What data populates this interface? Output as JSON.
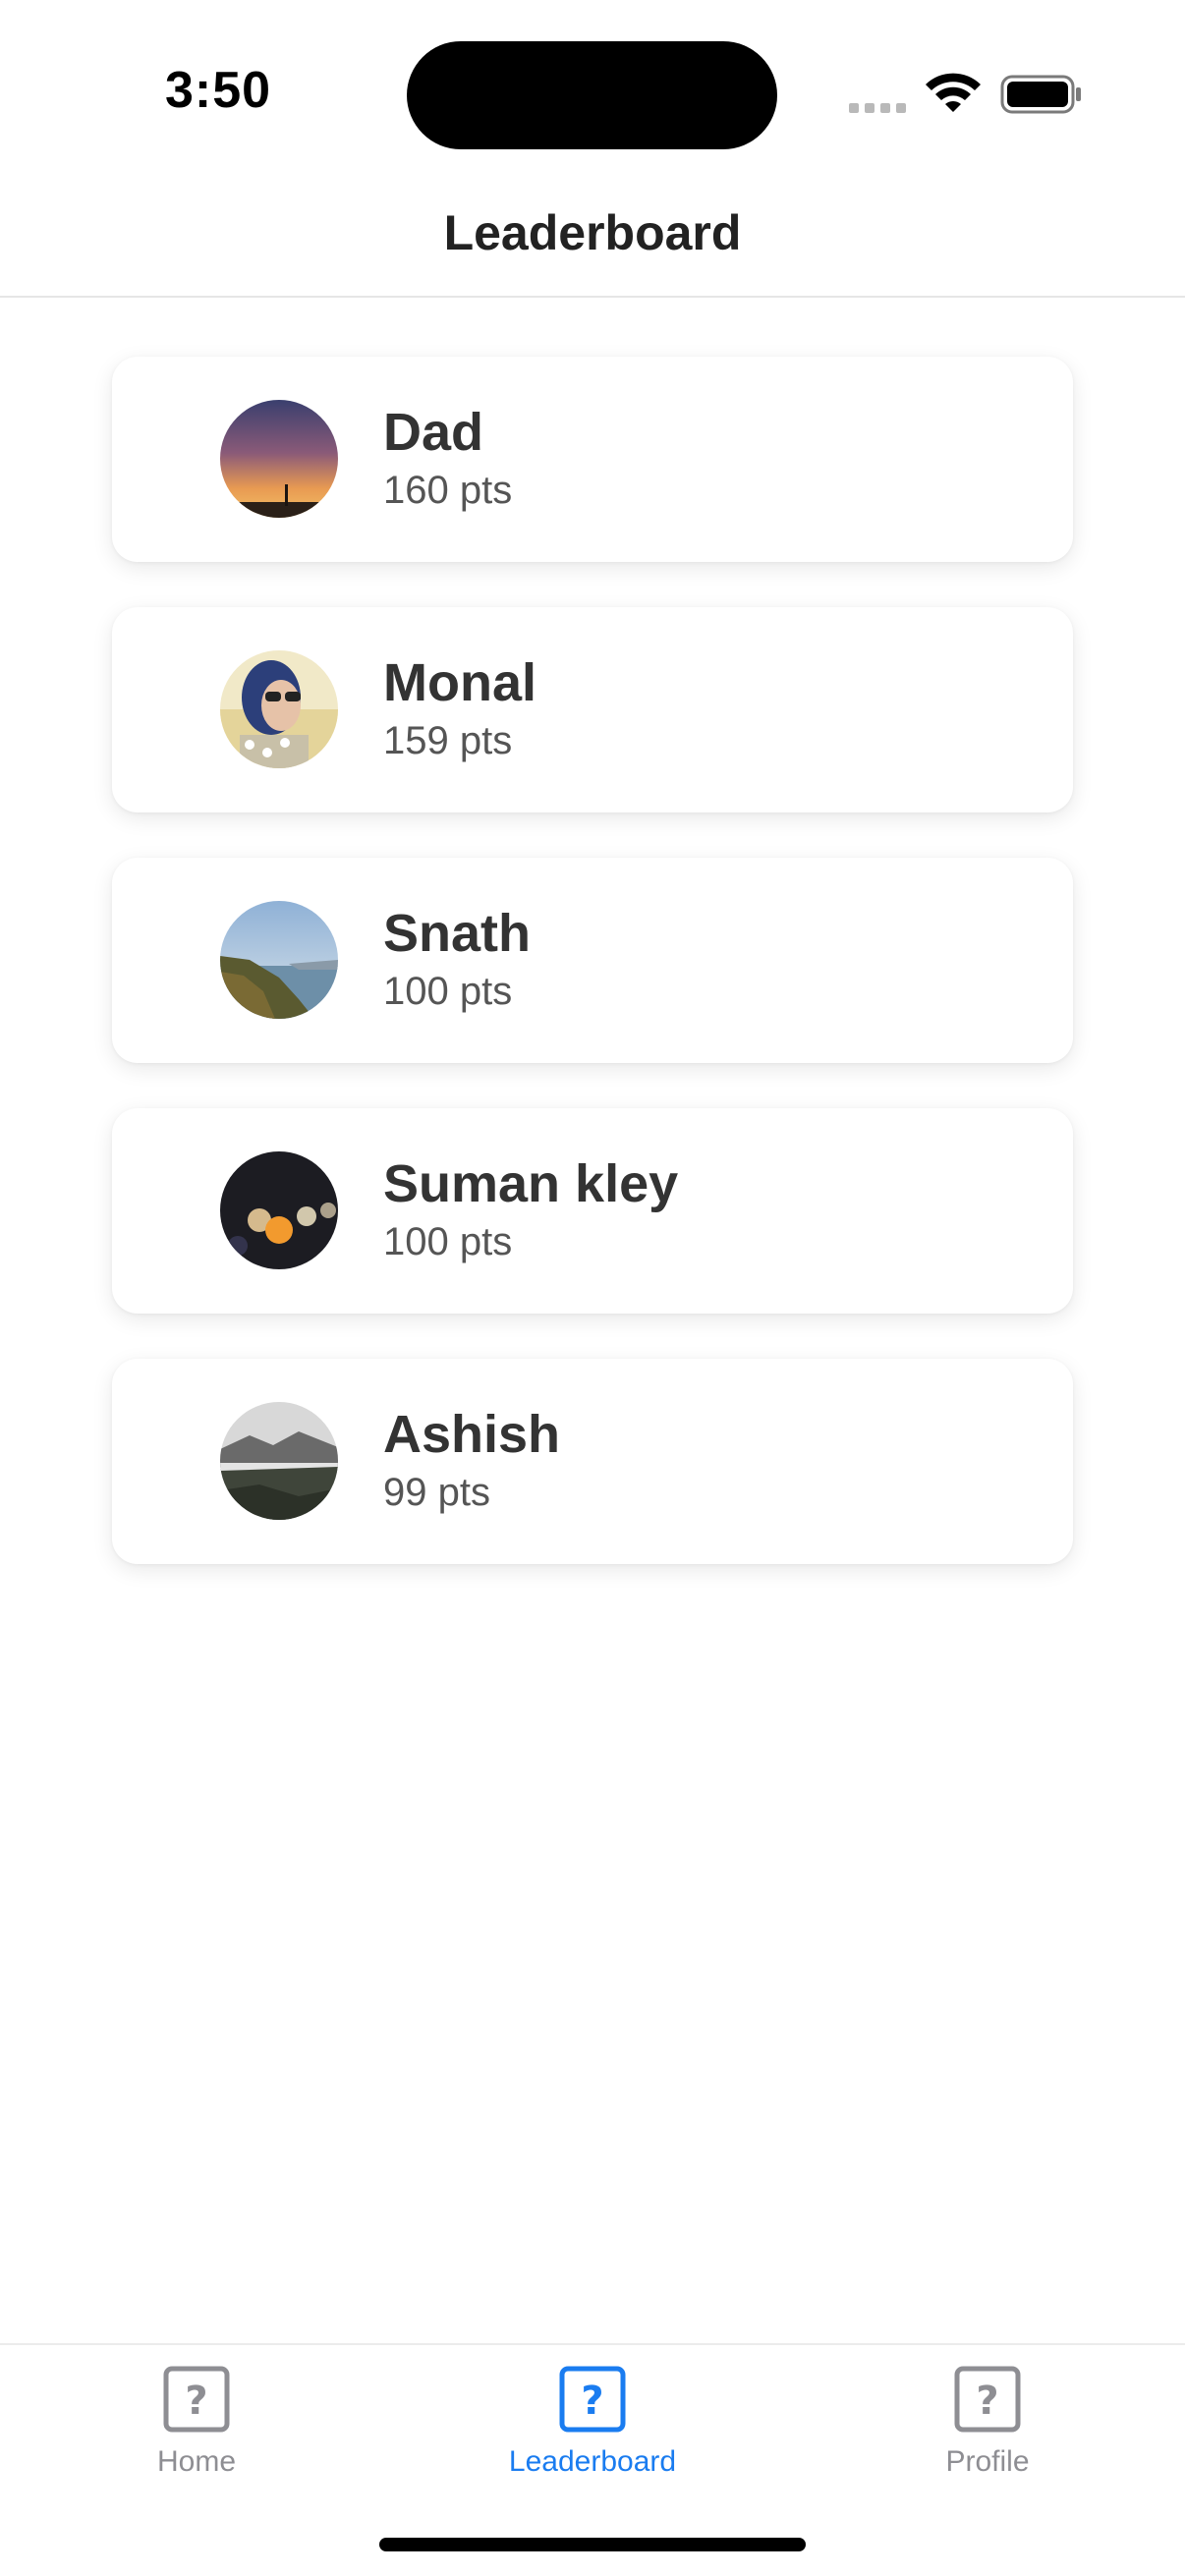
{
  "status_bar": {
    "time": "3:50"
  },
  "header": {
    "title": "Leaderboard"
  },
  "leaderboard": [
    {
      "name": "Dad",
      "points": "160 pts",
      "avatar": "sunset-avatar"
    },
    {
      "name": "Monal",
      "points": "159 pts",
      "avatar": "portrait-avatar"
    },
    {
      "name": "Snath",
      "points": "100 pts",
      "avatar": "coast-avatar"
    },
    {
      "name": "Suman kley",
      "points": "100 pts",
      "avatar": "bokeh-lights-avatar"
    },
    {
      "name": "Ashish",
      "points": "99 pts",
      "avatar": "mountain-lake-avatar"
    }
  ],
  "tabs": [
    {
      "label": "Home",
      "icon": "question-square-icon",
      "active": false
    },
    {
      "label": "Leaderboard",
      "icon": "question-square-icon",
      "active": true
    },
    {
      "label": "Profile",
      "icon": "question-square-icon",
      "active": false
    }
  ],
  "colors": {
    "accent": "#1a7cf0",
    "inactive_tab": "#8e8e93",
    "card_background": "#ffffff"
  }
}
